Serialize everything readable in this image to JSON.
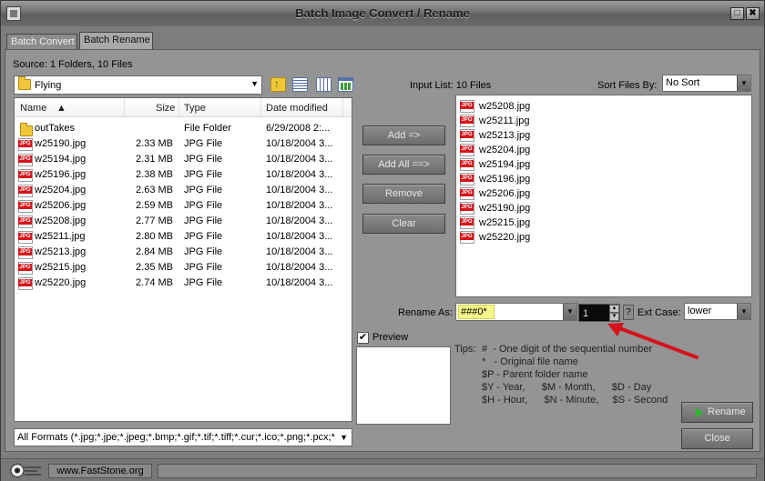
{
  "window": {
    "title": "Batch Image Convert / Rename",
    "restore_glyph": "□",
    "close_glyph": "✖"
  },
  "tabs": [
    {
      "label": "Batch Convert",
      "active": false
    },
    {
      "label": "Batch Rename",
      "active": true
    }
  ],
  "source": {
    "summary": "Source: 1 Folders, 10 Files",
    "folder": "Flying",
    "columns": [
      "Name",
      "Size",
      "Type",
      "Date modified"
    ],
    "rows": [
      {
        "name": "outTakes",
        "size": "",
        "type": "File Folder",
        "date": "6/29/2008 2:...",
        "icon": "folder-icon"
      },
      {
        "name": "w25190.jpg",
        "size": "2.33 MB",
        "type": "JPG File",
        "date": "10/18/2004 3...",
        "icon": "jpg-file-icon"
      },
      {
        "name": "w25194.jpg",
        "size": "2.31 MB",
        "type": "JPG File",
        "date": "10/18/2004 3...",
        "icon": "jpg-file-icon"
      },
      {
        "name": "w25196.jpg",
        "size": "2.38 MB",
        "type": "JPG File",
        "date": "10/18/2004 3...",
        "icon": "jpg-file-icon"
      },
      {
        "name": "w25204.jpg",
        "size": "2.63 MB",
        "type": "JPG File",
        "date": "10/18/2004 3...",
        "icon": "jpg-file-icon"
      },
      {
        "name": "w25206.jpg",
        "size": "2.59 MB",
        "type": "JPG File",
        "date": "10/18/2004 3...",
        "icon": "jpg-file-icon"
      },
      {
        "name": "w25208.jpg",
        "size": "2.77 MB",
        "type": "JPG File",
        "date": "10/18/2004 3...",
        "icon": "jpg-file-icon"
      },
      {
        "name": "w25211.jpg",
        "size": "2.80 MB",
        "type": "JPG File",
        "date": "10/18/2004 3...",
        "icon": "jpg-file-icon"
      },
      {
        "name": "w25213.jpg",
        "size": "2.84 MB",
        "type": "JPG File",
        "date": "10/18/2004 3...",
        "icon": "jpg-file-icon"
      },
      {
        "name": "w25215.jpg",
        "size": "2.35 MB",
        "type": "JPG File",
        "date": "10/18/2004 3...",
        "icon": "jpg-file-icon"
      },
      {
        "name": "w25220.jpg",
        "size": "2.74 MB",
        "type": "JPG File",
        "date": "10/18/2004 3...",
        "icon": "jpg-file-icon"
      }
    ],
    "formats": "All Formats (*.jpg;*.jpe;*.jpeg;*.bmp;*.gif;*.tif;*.tiff;*.cur;*.ico;*.png;*.pcx;*.j"
  },
  "actions": {
    "add": "Add =>",
    "add_all": "Add All ==>",
    "remove": "Remove",
    "clear": "Clear"
  },
  "input_list": {
    "label": "Input List:  10 Files",
    "sort_label": "Sort Files By:",
    "sort_value": "No Sort",
    "files": [
      "w25208.jpg",
      "w25211.jpg",
      "w25213.jpg",
      "w25204.jpg",
      "w25194.jpg",
      "w25196.jpg",
      "w25206.jpg",
      "w25190.jpg",
      "w25215.jpg",
      "w25220.jpg"
    ]
  },
  "rename": {
    "label": "Rename As:",
    "pattern": "###0*",
    "start_number": "1",
    "help": "?",
    "ext_case_label": "Ext Case:",
    "ext_case_value": "lower"
  },
  "preview": {
    "label": "Preview",
    "checked": true,
    "check_glyph": "✔"
  },
  "tips": {
    "label": "Tips:",
    "lines": [
      "#  - One digit of the sequential number",
      "*   - Original file name",
      "$P - Parent folder name",
      "$Y - Year,      $M - Month,      $D - Day",
      "$H - Hour,      $N - Minute,     $S - Second"
    ]
  },
  "buttons": {
    "rename": "Rename",
    "close": "Close"
  },
  "status": {
    "website": "www.FastStone.org"
  },
  "colors": {
    "annotation_arrow": "#d4141a",
    "pattern_highlight": "#f6f98a"
  }
}
